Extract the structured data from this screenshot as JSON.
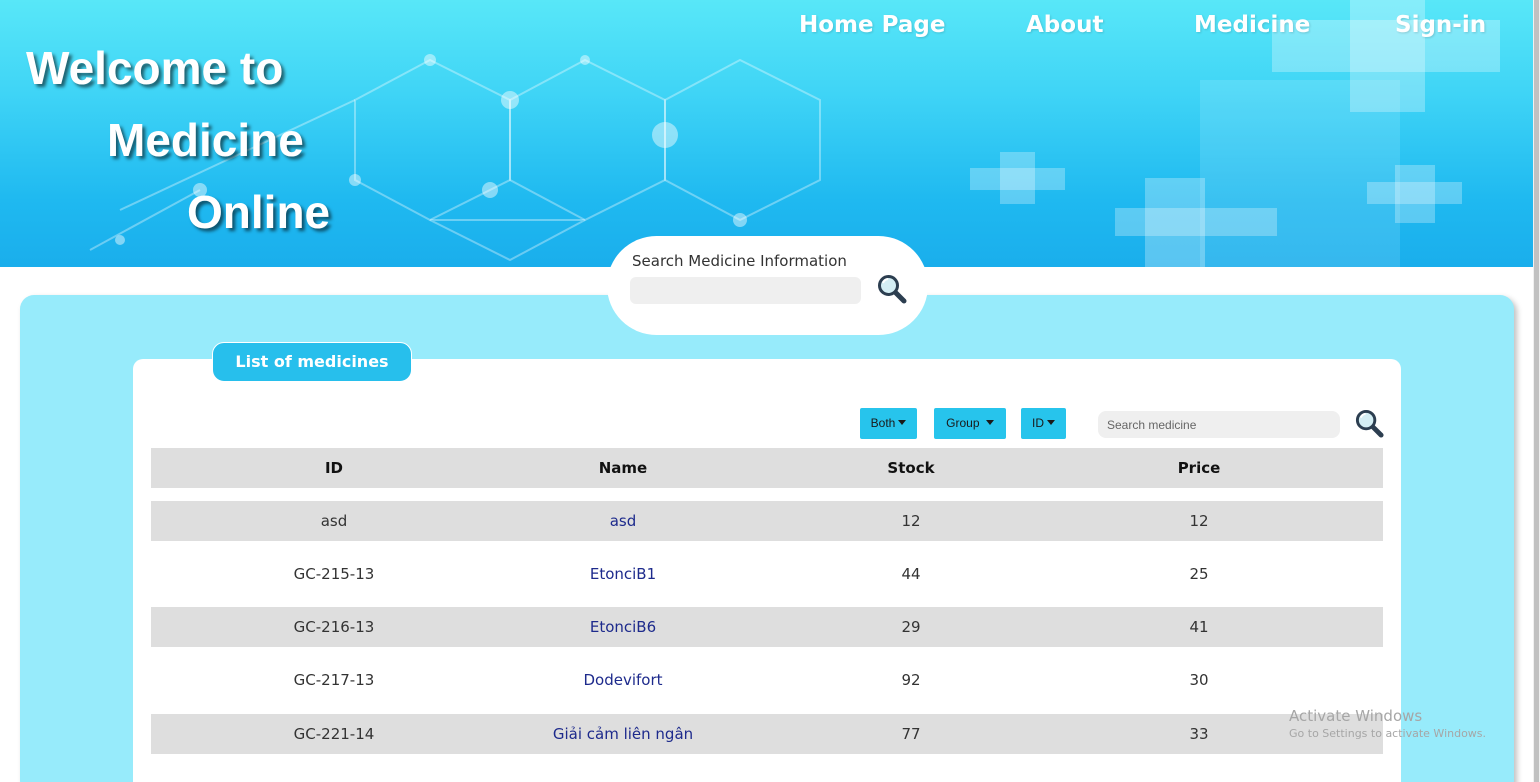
{
  "header": {
    "brand_lines": [
      "Welcome to",
      "Medicine",
      "Online"
    ],
    "nav": [
      "Home Page",
      "About",
      "Medicine",
      "Sign-in"
    ]
  },
  "hero_search": {
    "label": "Search Medicine Information",
    "value": "",
    "placeholder": ""
  },
  "list": {
    "title": "List of medicines",
    "filters": [
      "Both",
      "Group",
      "ID"
    ],
    "search_placeholder": "Search medicine",
    "columns": [
      "ID",
      "Name",
      "Stock",
      "Price"
    ],
    "rows": [
      {
        "id": "asd",
        "name": "asd",
        "stock": "12",
        "price": "12"
      },
      {
        "id": "GC-215-13",
        "name": "EtonciB1",
        "stock": "44",
        "price": "25"
      },
      {
        "id": "GC-216-13",
        "name": "EtonciB6",
        "stock": "29",
        "price": "41"
      },
      {
        "id": "GC-217-13",
        "name": "Dodevifort",
        "stock": "92",
        "price": "30"
      },
      {
        "id": "GC-221-14",
        "name": "Giải cảm liên ngân",
        "stock": "77",
        "price": "33"
      }
    ]
  },
  "watermark": {
    "line1": "Activate Windows",
    "line2": "Go to Settings to activate Windows."
  },
  "colors": {
    "banner": "#3fd4f6",
    "panel": "#97ebfb",
    "accent": "#27c4ec",
    "row_shade": "#dedede",
    "link": "#1d2a8c"
  },
  "icons": [
    "search-icon",
    "caret-down-icon"
  ]
}
